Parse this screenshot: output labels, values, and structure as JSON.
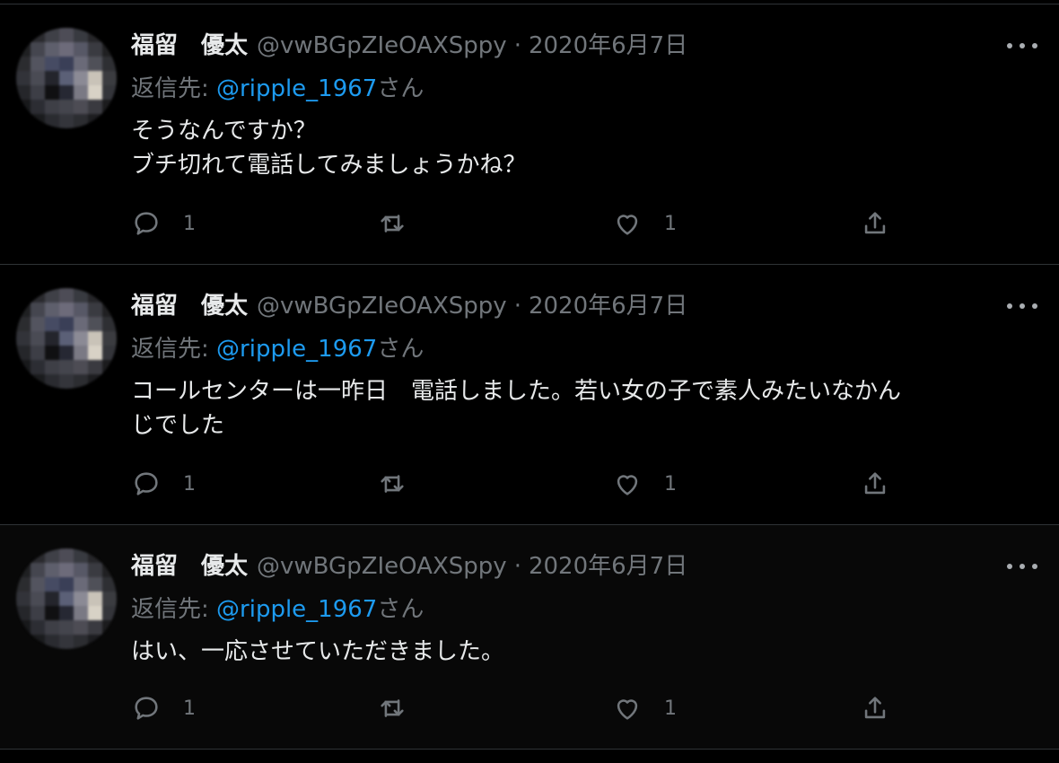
{
  "tweets": [
    {
      "display_name": "福留　優太",
      "handle": "@vwBGpZIeOAXSppy",
      "separator": "·",
      "date": "2020年6月7日",
      "reply_prefix": "返信先: ",
      "reply_mention": "@ripple_1967",
      "reply_suffix": "さん",
      "lines": [
        "そうなんですか？",
        "ブチ切れて電話してみましょうかね？"
      ],
      "reply_count": "1",
      "like_count": "1"
    },
    {
      "display_name": "福留　優太",
      "handle": "@vwBGpZIeOAXSppy",
      "separator": "·",
      "date": "2020年6月7日",
      "reply_prefix": "返信先: ",
      "reply_mention": "@ripple_1967",
      "reply_suffix": "さん",
      "lines": [
        "コールセンターは一昨日　電話しました。若い女の子で素人みたいなかん",
        "じでした"
      ],
      "reply_count": "1",
      "like_count": "1"
    },
    {
      "display_name": "福留　優太",
      "handle": "@vwBGpZIeOAXSppy",
      "separator": "·",
      "date": "2020年6月7日",
      "reply_prefix": "返信先: ",
      "reply_mention": "@ripple_1967",
      "reply_suffix": "さん",
      "lines": [
        "はい、一応させていただきました。"
      ],
      "reply_count": "1",
      "like_count": "1"
    }
  ],
  "icons": {
    "more": "more-horizontal-icon",
    "reply": "reply-bubble-icon",
    "retweet": "retweet-icon",
    "like": "heart-icon",
    "share": "share-icon"
  },
  "colors": {
    "background": "#000000",
    "text_primary": "#e7e9ea",
    "text_secondary": "#71767b",
    "mention": "#1d9bf0",
    "divider": "#2f3336"
  }
}
